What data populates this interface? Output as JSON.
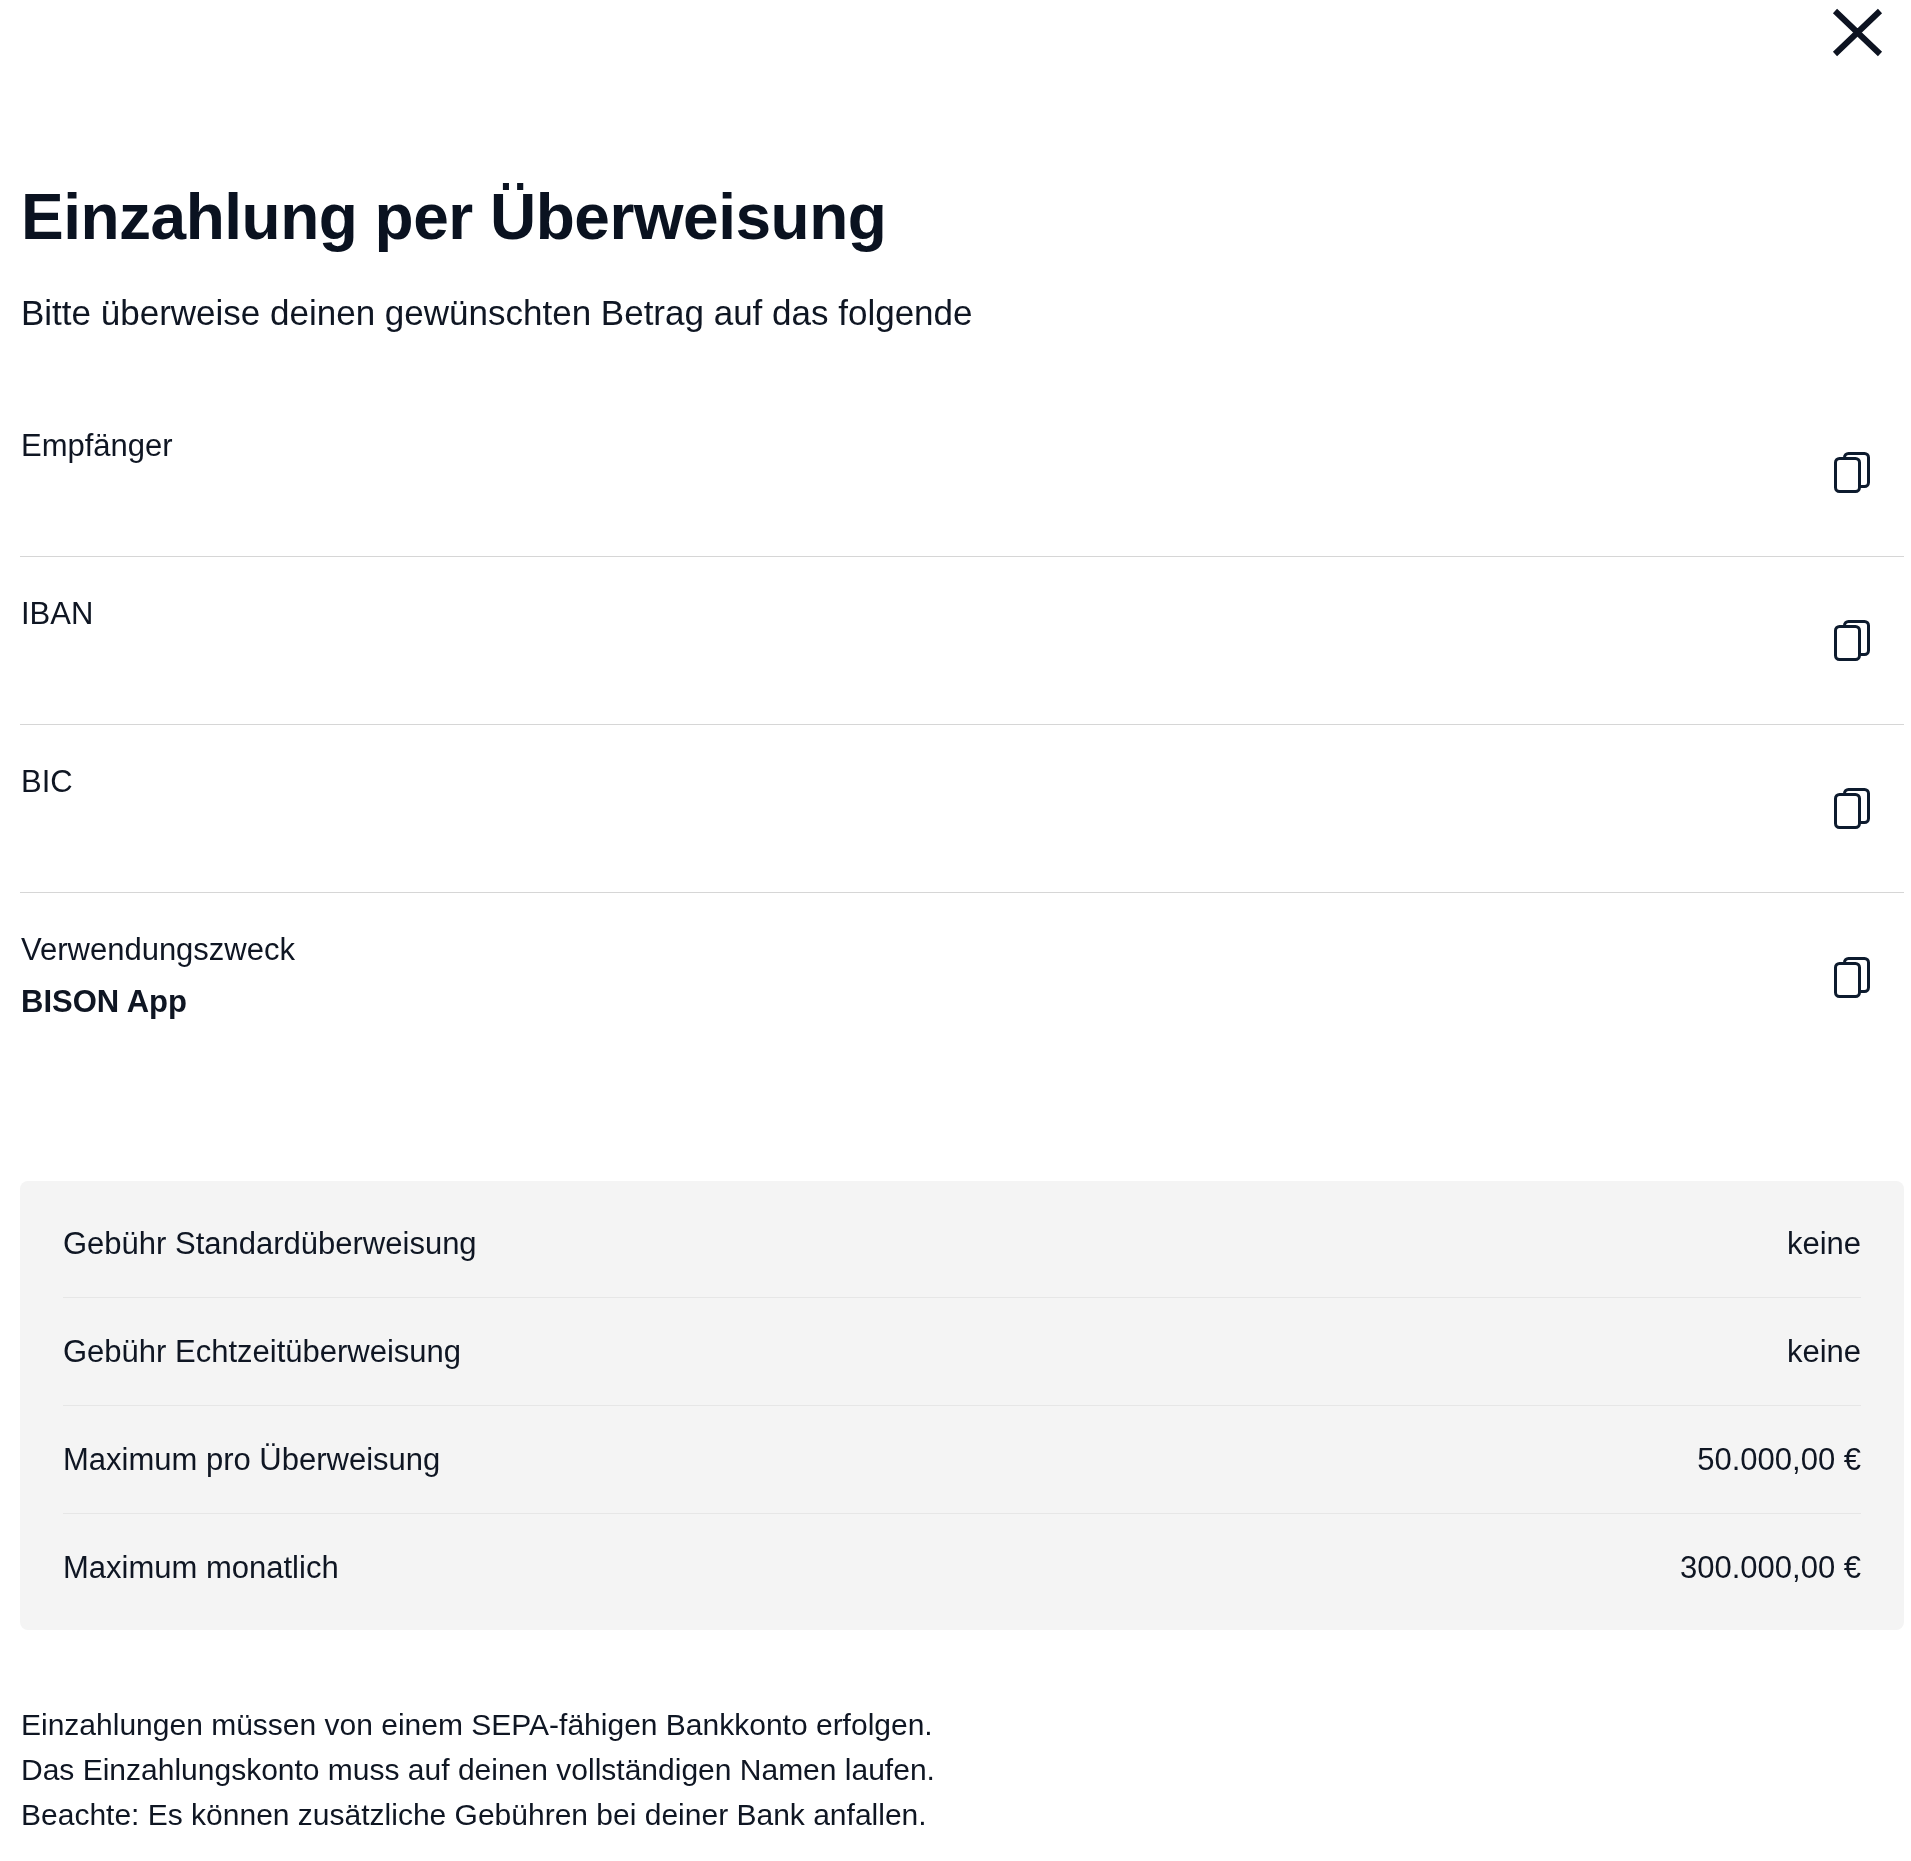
{
  "title": "Einzahlung per Überweisung",
  "subtitle": "Bitte überweise deinen gewünschten Betrag auf das folgende",
  "fields": [
    {
      "label": "Empfänger"
    },
    {
      "label": "IBAN"
    },
    {
      "label": "BIC"
    },
    {
      "label": "Verwendungszweck",
      "value": "BISON App"
    }
  ],
  "fees": [
    {
      "label": "Gebühr Standardüberweisung",
      "value": "keine"
    },
    {
      "label": "Gebühr Echtzeitüberweisung",
      "value": "keine"
    },
    {
      "label": "Maximum pro Überweisung",
      "value": "50.000,00 €"
    },
    {
      "label": "Maximum monatlich",
      "value": "300.000,00 €"
    }
  ],
  "notes": [
    "Einzahlungen müssen von einem SEPA-fähigen Bankkonto erfolgen.",
    "Das Einzahlungskonto muss auf deinen vollständigen Namen laufen.",
    "Beachte: Es können zusätzliche Gebühren bei deiner Bank anfallen."
  ]
}
